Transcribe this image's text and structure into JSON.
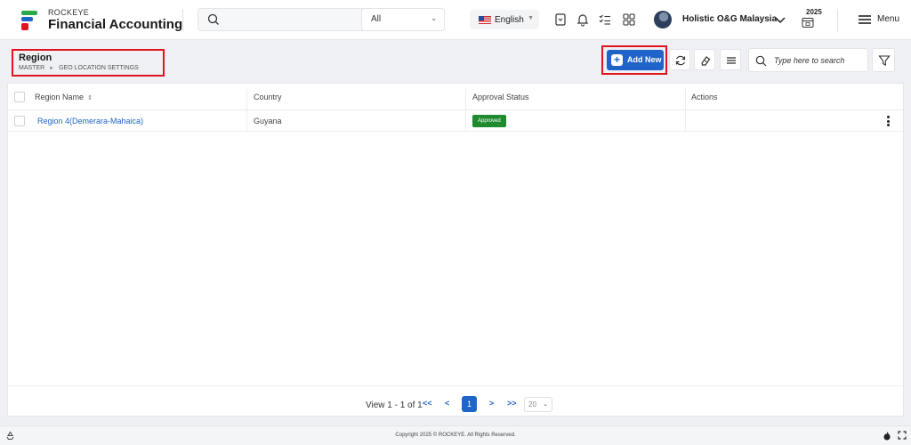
{
  "app": {
    "brand_small": "ROCKEYE",
    "brand_main": "Financial Accounting",
    "search_scope": "All",
    "language": "English",
    "company": "Holistic O&G Malaysia",
    "year": "2025",
    "menu_label": "Menu",
    "accent_color": "#1f64c8",
    "highlight_color": "#e0141e"
  },
  "page": {
    "title": "Region",
    "breadcrumb": [
      "MASTER",
      "GEO LOCATION SETTINGS"
    ],
    "add_new_label": "Add New",
    "search_placeholder": "Type here to search"
  },
  "table": {
    "columns": [
      "Region Name",
      "Country",
      "Approval Status",
      "Actions"
    ],
    "rows": [
      {
        "region_name": "Region 4(Demerara-Mahaica)",
        "country": "Guyana",
        "status": "Approved"
      }
    ]
  },
  "pagination": {
    "summary": "View 1 - 1 of 1",
    "first": "<<",
    "prev": "<",
    "current_page": "1",
    "next": ">",
    "last": ">>",
    "page_size": "20"
  },
  "footer": {
    "copyright": "Copyright 2025 © ROCKEYE. All Rights Reserved."
  },
  "icons": {
    "top_search": "search-icon",
    "bookmark": "bookmark-icon",
    "notifications": "bell-icon",
    "tasks": "checklist-icon",
    "apps": "grid-icon",
    "refresh": "refresh-icon",
    "clear": "eraser-icon",
    "columns": "list-icon",
    "filter": "filter-icon"
  }
}
